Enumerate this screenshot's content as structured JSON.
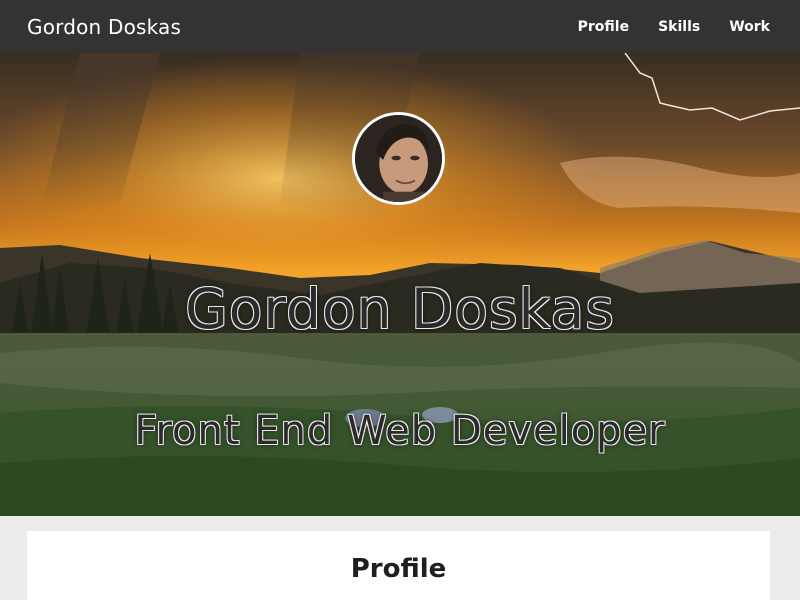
{
  "navbar": {
    "brand": "Gordon Doskas",
    "links": [
      "Profile",
      "Skills",
      "Work"
    ]
  },
  "hero": {
    "name": "Gordon Doskas",
    "title": "Front End Web Developer",
    "avatar": "profile-photo"
  },
  "section": {
    "title": "Profile"
  },
  "colors": {
    "navbar_bg": "#333333",
    "page_bg": "#ececec",
    "card_bg": "#ffffff",
    "hero_text": "#2a2a2a",
    "sky_glow": "#f5a623"
  }
}
